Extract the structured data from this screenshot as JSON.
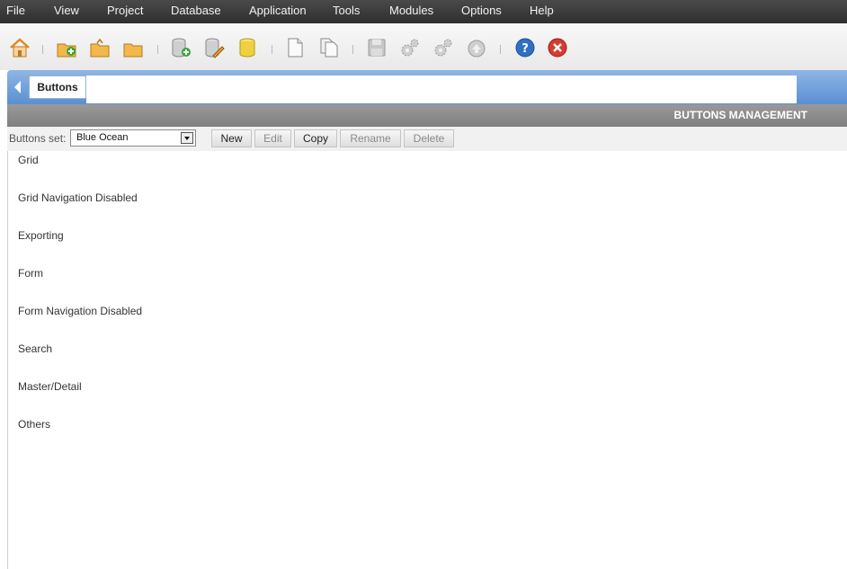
{
  "menu": [
    "File",
    "View",
    "Project",
    "Database",
    "Application",
    "Tools",
    "Modules",
    "Options",
    "Help"
  ],
  "toolbar": {
    "icons": [
      "home-icon",
      "new-project-icon",
      "open-project-icon",
      "folder-icon",
      "new-connection-icon",
      "edit-connection-icon",
      "database-icon",
      "new-document-icon",
      "copy-document-icon",
      "save-icon",
      "generate-icon",
      "run-icon",
      "deploy-icon",
      "help-icon",
      "close-icon"
    ]
  },
  "tab": {
    "label": "Buttons"
  },
  "section": {
    "title": "BUTTONS MANAGEMENT"
  },
  "buttons_set": {
    "label": "Buttons set:",
    "value": "Blue Ocean",
    "actions": {
      "new": "New",
      "edit": "Edit",
      "copy": "Copy",
      "rename": "Rename",
      "delete": "Delete"
    }
  },
  "groups": [
    "Grid",
    "Grid Navigation Disabled",
    "Exporting",
    "Form",
    "Form Navigation Disabled",
    "Search",
    "Master/Detail",
    "Others"
  ]
}
